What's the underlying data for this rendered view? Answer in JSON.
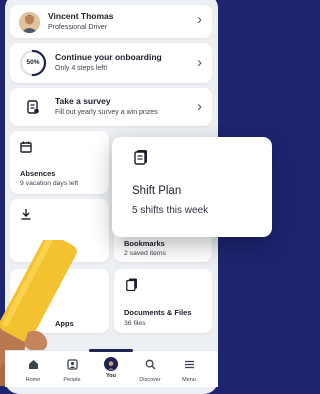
{
  "profile": {
    "name": "Vincent Thomas",
    "role": "Professional Driver"
  },
  "onboarding": {
    "progress_label": "50%",
    "progress": 0.5,
    "title": "Continue your onboarding",
    "subtitle": "Only 4 steps left!"
  },
  "survey": {
    "title": "Take a survey",
    "subtitle": "Fill out yearly survey a win prizes"
  },
  "tiles": {
    "absences": {
      "title": "Absences",
      "subtitle": "9 vacation days left"
    },
    "bookmarks": {
      "title": "Bookmarks",
      "subtitle": "2 saved items"
    },
    "documents": {
      "title": "Documents & Files",
      "subtitle": "36 files"
    },
    "apps": {
      "title": "Apps"
    }
  },
  "shift_plan": {
    "title": "Shift Plan",
    "subtitle": "5 shifts this week"
  },
  "bottom_nav": {
    "home": "Home",
    "people": "People",
    "you": "You",
    "discover": "Discover",
    "menu": "Menu"
  },
  "colors": {
    "background": "#1d2470",
    "accent_navy": "#1e2452",
    "progress_ring": "#1e2452",
    "hand_phone": "#f2c230"
  },
  "icons": [
    "chevron-right-icon",
    "survey-icon",
    "calendar-icon",
    "download-icon",
    "document-icon",
    "files-icon",
    "home-icon",
    "people-icon",
    "search-icon",
    "menu-icon"
  ]
}
